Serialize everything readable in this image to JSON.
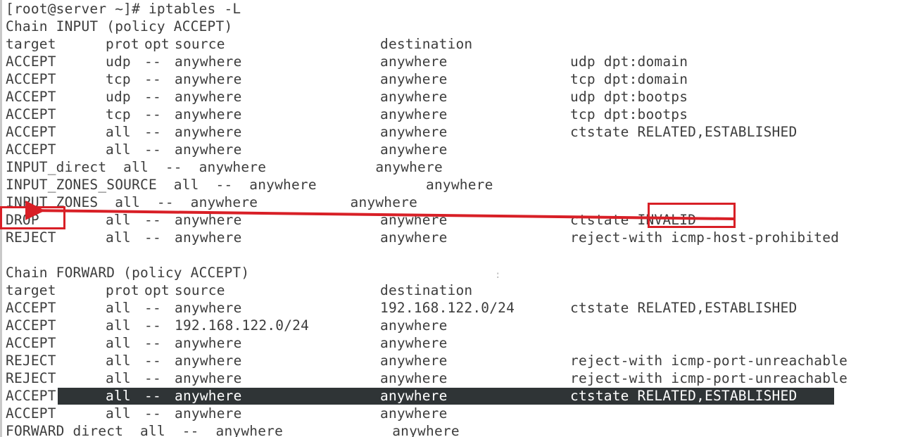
{
  "terminal": {
    "prompt_line": "[root@server ~]# iptables -L",
    "colors": {
      "background": "#ffffff",
      "text": "#3d3d3d",
      "selection_background": "#2f3436",
      "selection_text": "#ffffff",
      "annotation": "#d81f26"
    },
    "columns": {
      "target": "target",
      "prot": "prot",
      "opt": "opt",
      "source": "source",
      "destination": "destination"
    },
    "chains": [
      {
        "header": "Chain INPUT (policy ACCEPT)",
        "name": "INPUT",
        "policy": "ACCEPT"
      },
      {
        "header": "Chain FORWARD (policy ACCEPT)",
        "name": "FORWARD",
        "policy": "ACCEPT"
      }
    ],
    "lines": [
      {
        "kind": "prompt",
        "text": "[root@server ~]# iptables -L"
      },
      {
        "kind": "chain",
        "text": "Chain INPUT (policy ACCEPT)"
      },
      {
        "kind": "header",
        "target": "target",
        "prot": "prot",
        "opt": "opt",
        "source": "source",
        "destination": "destination",
        "extra": ""
      },
      {
        "kind": "rule",
        "target": "ACCEPT",
        "prot": "udp",
        "opt": "--",
        "source": "anywhere",
        "destination": "anywhere",
        "extra": "udp dpt:domain"
      },
      {
        "kind": "rule",
        "target": "ACCEPT",
        "prot": "tcp",
        "opt": "--",
        "source": "anywhere",
        "destination": "anywhere",
        "extra": "tcp dpt:domain"
      },
      {
        "kind": "rule",
        "target": "ACCEPT",
        "prot": "udp",
        "opt": "--",
        "source": "anywhere",
        "destination": "anywhere",
        "extra": "udp dpt:bootps"
      },
      {
        "kind": "rule",
        "target": "ACCEPT",
        "prot": "tcp",
        "opt": "--",
        "source": "anywhere",
        "destination": "anywhere",
        "extra": "tcp dpt:bootps"
      },
      {
        "kind": "rule",
        "target": "ACCEPT",
        "prot": "all",
        "opt": "--",
        "source": "anywhere",
        "destination": "anywhere",
        "extra": "ctstate RELATED,ESTABLISHED"
      },
      {
        "kind": "rule",
        "target": "ACCEPT",
        "prot": "all",
        "opt": "--",
        "source": "anywhere",
        "destination": "anywhere",
        "extra": ""
      },
      {
        "kind": "flow",
        "text": "INPUT_direct  all  --  anywhere             anywhere"
      },
      {
        "kind": "flow",
        "text": "INPUT_ZONES_SOURCE  all  --  anywhere             anywhere"
      },
      {
        "kind": "flow",
        "text": "INPUT_ZONES  all  --  anywhere           anywhere"
      },
      {
        "kind": "rule",
        "target": "DROP",
        "prot": "all",
        "opt": "--",
        "source": "anywhere",
        "destination": "anywhere",
        "extra": "ctstate INVALID"
      },
      {
        "kind": "rule",
        "target": "REJECT",
        "prot": "all",
        "opt": "--",
        "source": "anywhere",
        "destination": "anywhere",
        "extra": "reject-with icmp-host-prohibited"
      },
      {
        "kind": "blank",
        "text": ""
      },
      {
        "kind": "chain",
        "text": "Chain FORWARD (policy ACCEPT)"
      },
      {
        "kind": "header",
        "target": "target",
        "prot": "prot",
        "opt": "opt",
        "source": "source",
        "destination": "destination",
        "extra": ""
      },
      {
        "kind": "rule",
        "target": "ACCEPT",
        "prot": "all",
        "opt": "--",
        "source": "anywhere",
        "destination": "192.168.122.0/24",
        "extra": "ctstate RELATED,ESTABLISHED"
      },
      {
        "kind": "rule",
        "target": "ACCEPT",
        "prot": "all",
        "opt": "--",
        "source": "192.168.122.0/24",
        "destination": "anywhere",
        "extra": ""
      },
      {
        "kind": "rule",
        "target": "ACCEPT",
        "prot": "all",
        "opt": "--",
        "source": "anywhere",
        "destination": "anywhere",
        "extra": ""
      },
      {
        "kind": "rule",
        "target": "REJECT",
        "prot": "all",
        "opt": "--",
        "source": "anywhere",
        "destination": "anywhere",
        "extra": "reject-with icmp-port-unreachable"
      },
      {
        "kind": "rule",
        "target": "REJECT",
        "prot": "all",
        "opt": "--",
        "source": "anywhere",
        "destination": "anywhere",
        "extra": "reject-with icmp-port-unreachable"
      },
      {
        "kind": "rule",
        "selected": true,
        "target": "ACCEPT",
        "prot": "all",
        "opt": "--",
        "source": "anywhere",
        "destination": "anywhere",
        "extra": "ctstate RELATED,ESTABLISHED"
      },
      {
        "kind": "rule",
        "target": "ACCEPT",
        "prot": "all",
        "opt": "--",
        "source": "anywhere",
        "destination": "anywhere",
        "extra": ""
      },
      {
        "kind": "flow",
        "text": "FORWARD_direct  all  --  anywhere             anywhere"
      }
    ]
  },
  "annotations": {
    "drop_box_label": "DROP",
    "invalid_box_label": "INVALID",
    "arrow_description": "red arrow from INVALID to DROP"
  }
}
